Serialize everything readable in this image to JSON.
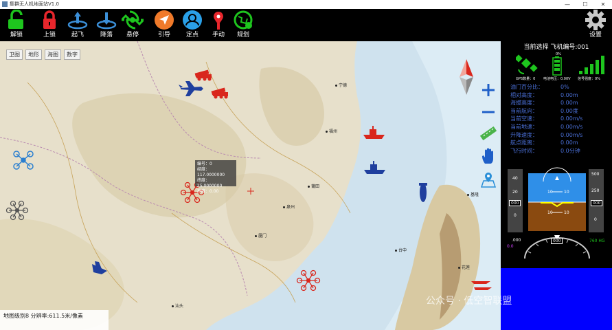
{
  "window": {
    "title": "集群无人机地面站V1.0",
    "min_glyph": "—",
    "max_glyph": "☐",
    "close_glyph": "✕"
  },
  "toolbar": {
    "tools": [
      {
        "label": "解锁",
        "icon": "unlock-icon",
        "color": "#1ec51e"
      },
      {
        "label": "上锁",
        "icon": "lock-icon",
        "color": "#e8262c"
      },
      {
        "label": "起飞",
        "icon": "takeoff-icon",
        "color": "#3b8fd8"
      },
      {
        "label": "降落",
        "icon": "landing-icon",
        "color": "#3b8fd8"
      },
      {
        "label": "悬停",
        "icon": "hover-icon",
        "color": "#1ec51e"
      },
      {
        "label": "引导",
        "icon": "guide-icon",
        "color": "#f07a2a"
      },
      {
        "label": "定点",
        "icon": "fixed-point-icon",
        "color": "#2aa0e8"
      },
      {
        "label": "手动",
        "icon": "manual-icon",
        "color": "#e8262c"
      },
      {
        "label": "规划",
        "icon": "plan-icon",
        "color": "#1ec51e"
      }
    ],
    "settings_label": "设置"
  },
  "map": {
    "tabs": [
      "卫图",
      "地形",
      "海图",
      "数字"
    ],
    "cities": [
      "宁德",
      "福州",
      "莆田",
      "泉州",
      "厦门",
      "台中",
      "花莲",
      "基隆",
      "汕头"
    ],
    "info": {
      "id_line": "编号：0",
      "lon_line": "经度：117.0000000",
      "lat_line": "纬度：25.0000000",
      "alt_line": "高度：0.00"
    },
    "status": "地图级别8  分辨率:611.5米/像素",
    "colors": {
      "land": "#e8e2cf",
      "sea": "#cfe3ef",
      "hostile": "#d9261c",
      "friendly": "#1f3f9e"
    }
  },
  "panel": {
    "vehicle_selection": "当前选择 飞机编号:001",
    "battery_percent_label": "0%",
    "status_labels": [
      "GPS数量：0",
      "电池电压：0.00V",
      "信号强度：0%"
    ],
    "telemetry": [
      {
        "label": "油门百分比：",
        "value": "0%"
      },
      {
        "label": "相对高度：",
        "value": "0.00m"
      },
      {
        "label": "海拔高度：",
        "value": "0.00m"
      },
      {
        "label": "当前航向：",
        "value": "0.00度"
      },
      {
        "label": "当前空速：",
        "value": "0.00m/s"
      },
      {
        "label": "当前地速：",
        "value": "0.00m/s"
      },
      {
        "label": "升降速度：",
        "value": "0.00m/s"
      },
      {
        "label": "航点距离：",
        "value": "0.00m"
      },
      {
        "label": "飞行时间：",
        "value": "0.0分钟"
      }
    ],
    "pfd": {
      "speed_ticks": [
        "40",
        "20",
        "0"
      ],
      "speed_box": "000",
      "alt_ticks": [
        "500",
        "250",
        "0"
      ],
      "alt_box": "000",
      "pitch_labels": [
        "10",
        "10",
        "10",
        "10"
      ],
      "bottom_left": ".000",
      "mode": "0.0",
      "heading_box": "000",
      "altimeter": "760 HG"
    }
  },
  "watermark": "公众号 · 低空智联盟"
}
